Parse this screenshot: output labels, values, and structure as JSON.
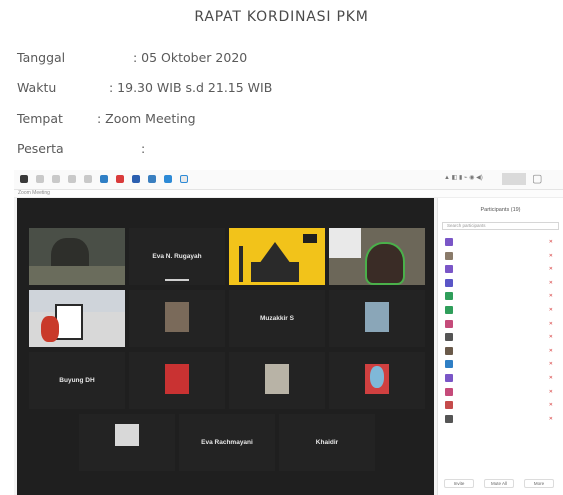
{
  "document": {
    "title": "RAPAT KORDINASI PKM",
    "rows": [
      {
        "label": "Tanggal",
        "value": ": 05 Oktober 2020"
      },
      {
        "label": "Waktu",
        "value": ": 19.30 WIB s.d 21.15 WIB"
      },
      {
        "label": "Tempat",
        "value": ": Zoom Meeting"
      },
      {
        "label": "Peserta",
        "value": ":"
      }
    ]
  },
  "zoom": {
    "window_title": "Zoom Meeting",
    "titlebar_right": "Zoom Meeting",
    "panel_title": "Participants (19)",
    "search_placeholder": "Search participants",
    "tiles": [
      {
        "name": "",
        "caption": ""
      },
      {
        "name": "Eva N. Rugayah",
        "caption": ""
      },
      {
        "name": "",
        "caption": ""
      },
      {
        "name": "",
        "caption": ""
      },
      {
        "name": "",
        "caption": ""
      },
      {
        "name": "",
        "caption": ""
      },
      {
        "name": "Muzakkir S",
        "caption": ""
      },
      {
        "name": "",
        "caption": ""
      },
      {
        "name": "Buyung DH",
        "caption": ""
      },
      {
        "name": "",
        "caption": ""
      },
      {
        "name": "",
        "caption": ""
      },
      {
        "name": "",
        "caption": ""
      },
      {
        "name": "",
        "caption": ""
      },
      {
        "name": "Eva Rachmayani",
        "caption": ""
      },
      {
        "name": "Khaidir",
        "caption": ""
      }
    ],
    "participants": [
      {
        "name": "",
        "color": "#7a56c7"
      },
      {
        "name": "",
        "color": "#8a7b6a"
      },
      {
        "name": "",
        "color": "#7a56c7"
      },
      {
        "name": "",
        "color": "#5a56c7"
      },
      {
        "name": "",
        "color": "#2f9e5a"
      },
      {
        "name": "",
        "color": "#2f9e5a"
      },
      {
        "name": "",
        "color": "#c54b7a"
      },
      {
        "name": "",
        "color": "#555555"
      },
      {
        "name": "",
        "color": "#6a5a4a"
      },
      {
        "name": "",
        "color": "#2f7fc5"
      },
      {
        "name": "",
        "color": "#7a56c7"
      },
      {
        "name": "",
        "color": "#c54b7a"
      },
      {
        "name": "",
        "color": "#c54b4b"
      },
      {
        "name": "",
        "color": "#555555"
      }
    ],
    "footer": {
      "invite": "Invite",
      "mute_all": "Mute All",
      "more": "More"
    }
  }
}
